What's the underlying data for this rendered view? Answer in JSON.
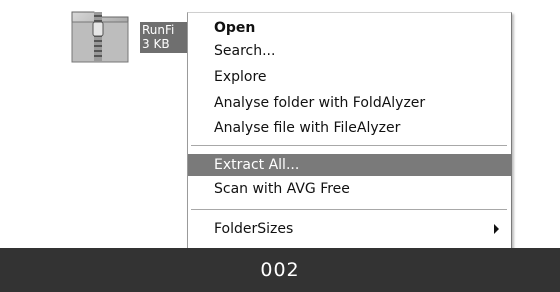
{
  "file": {
    "icon": "zip-folder-icon",
    "name": "RunFi",
    "size": "3 KB"
  },
  "context_menu": {
    "items": [
      {
        "label": "Open"
      },
      {
        "label": "Search..."
      },
      {
        "label": "Explore"
      },
      {
        "label": "Analyse folder with FoldAlyzer"
      },
      {
        "label": "Analyse file with FileAlyzer"
      },
      {
        "label": "Extract All..."
      },
      {
        "label": "Scan with AVG Free"
      },
      {
        "label": "FolderSizes"
      }
    ],
    "highlighted_item": "Extract All...",
    "submenu_icon": "submenu-arrow-icon"
  },
  "footer": {
    "label": "002"
  },
  "colors": {
    "highlight_bg": "#7a7a7a",
    "footer_bg": "#333333",
    "selection_bg": "#6f6f6f"
  }
}
